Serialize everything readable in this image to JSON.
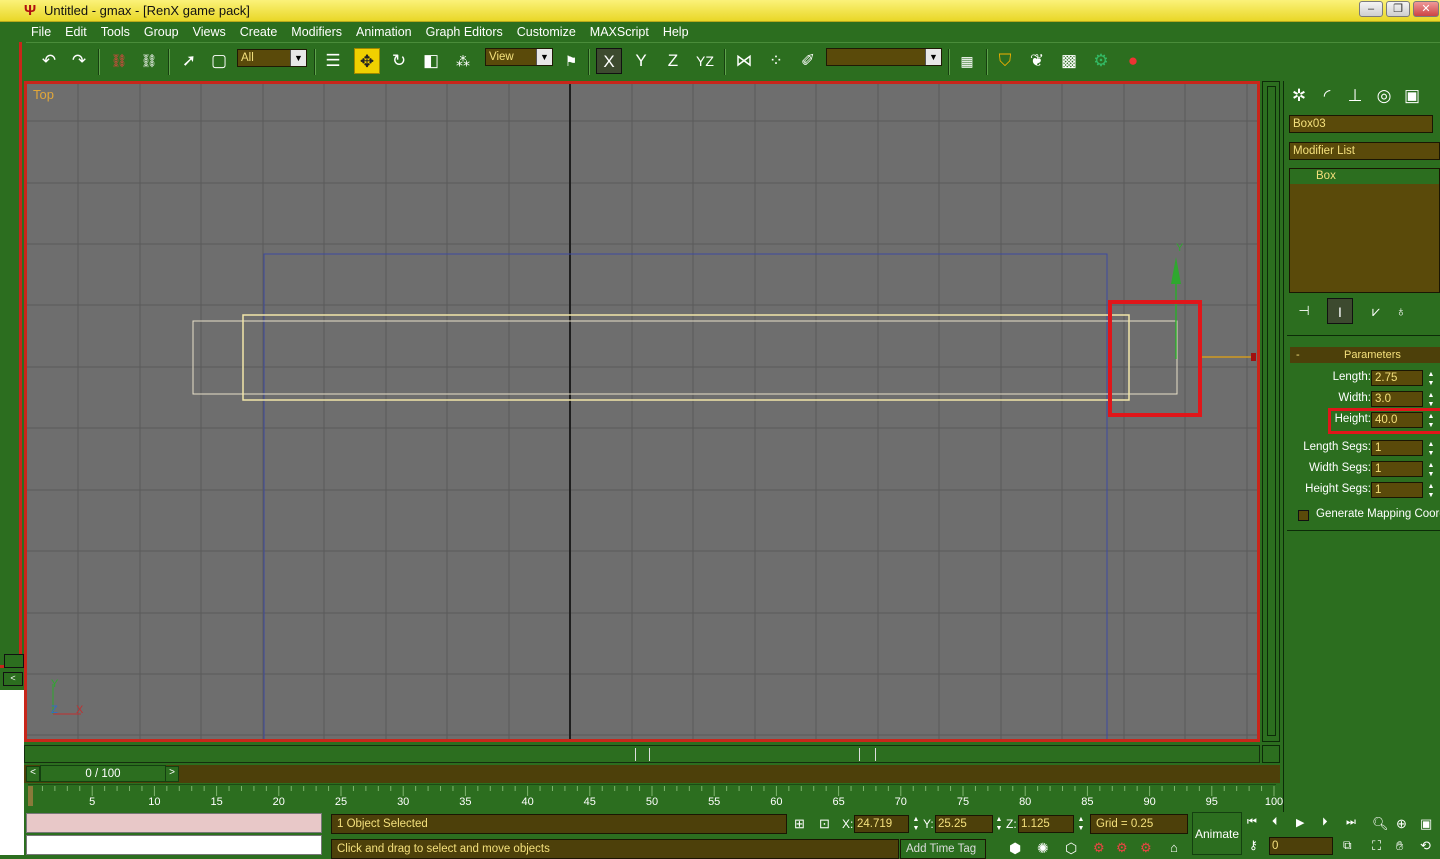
{
  "window": {
    "title": "Untitled - gmax - [RenX game pack]",
    "minimize": "–",
    "restore": "❐",
    "close": "✕"
  },
  "menu": [
    "File",
    "Edit",
    "Tools",
    "Group",
    "Views",
    "Create",
    "Modifiers",
    "Animation",
    "Graph Editors",
    "Customize",
    "MAXScript",
    "Help"
  ],
  "toolbar": {
    "selection_filter": "All",
    "reference_coord": "View",
    "named_selection": "",
    "constraint_labels": [
      "X",
      "Y",
      "Z",
      "YZ"
    ]
  },
  "viewport": {
    "label": "Top",
    "axis_y": "Y",
    "axis_x": "X",
    "axis_z": "Z",
    "gizmo_y": "Y"
  },
  "command_panel": {
    "object_name": "Box03",
    "modifier_list": "Modifier List",
    "stack_item": "Box",
    "rollout_title": "Parameters",
    "rollout_toggle": "-",
    "parameters": [
      {
        "label": "Length:",
        "value": "2.75"
      },
      {
        "label": "Width:",
        "value": "3.0"
      },
      {
        "label": "Height:",
        "value": "40.0"
      },
      {
        "label": "Length Segs:",
        "value": "1"
      },
      {
        "label": "Width Segs:",
        "value": "1"
      },
      {
        "label": "Height Segs:",
        "value": "1"
      }
    ],
    "generate_mapping": "Generate Mapping Coords."
  },
  "time": {
    "frame": "0 / 100",
    "ticks": [
      "5",
      "10",
      "15",
      "20",
      "25",
      "30",
      "35",
      "40",
      "45",
      "50",
      "55",
      "60",
      "65",
      "70",
      "75",
      "80",
      "85",
      "90",
      "95",
      "100"
    ]
  },
  "status": {
    "selection": "1 Object Selected",
    "prompt": "Click and drag to select and move objects",
    "x_label": "X:",
    "x": "24.719",
    "y_label": "Y:",
    "y": "25.25",
    "z_label": "Z:",
    "z": "1.125",
    "grid": "Grid = 0.25",
    "add_time_tag": "Add Time Tag",
    "animate": "Animate",
    "current_frame": "0"
  }
}
